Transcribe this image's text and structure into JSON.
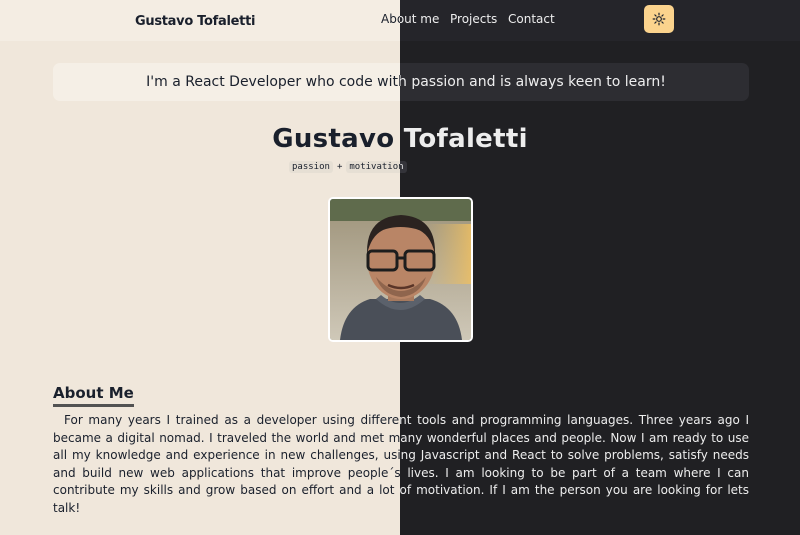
{
  "nav": {
    "brand": "Gustavo Tofaletti",
    "links": [
      "About me",
      "Projects",
      "Contact"
    ],
    "theme_icon": "sun-icon"
  },
  "banner": {
    "text": "I'm a React Developer who code with passion and is always keen to learn!"
  },
  "profile": {
    "name": "Gustavo Tofaletti",
    "tags": [
      "passion",
      "motivation"
    ],
    "tag_separator": "+"
  },
  "about": {
    "title": "About Me",
    "text": "For many years I trained as a developer using different tools and programming languages. Three years ago I became a digital nomad. I traveled the world and met many wonderful places and people. Now I am ready to use all my knowledge and experience in new challenges, using Javascript and React to solve problems, satisfy needs and build new web applications that improve people´s lives. I am looking to be part of a team where I can contribute my skills and grow based on effort and a lot of motivation. If I am the person you are looking for lets talk!"
  },
  "colors": {
    "light_bg": "#f0e7db",
    "dark_bg": "#202023",
    "accent": "#fbd38d"
  }
}
